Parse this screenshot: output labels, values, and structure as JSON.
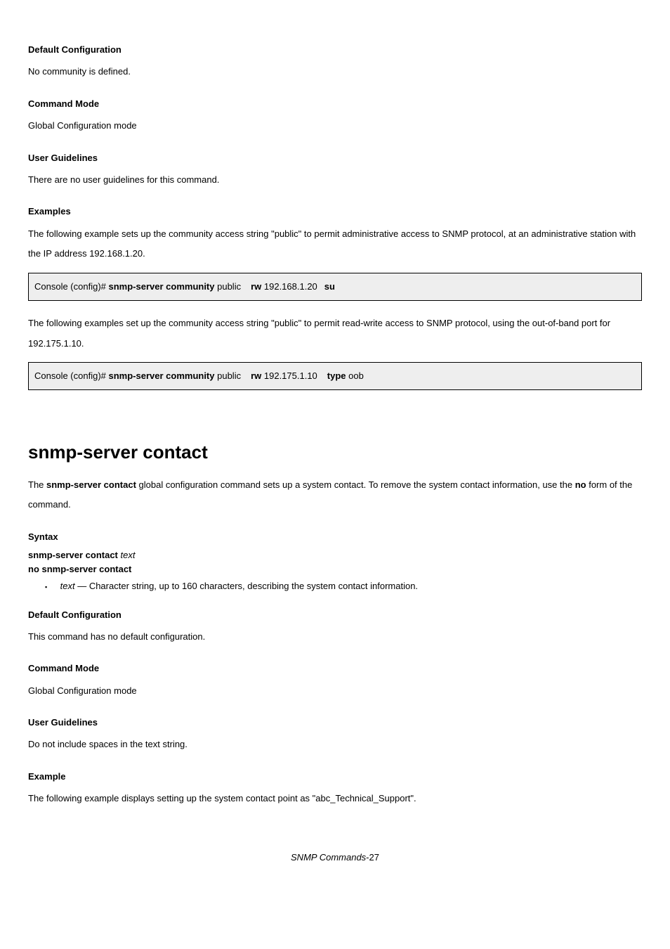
{
  "default_cfg": {
    "title": "Default Configuration",
    "text": "No community is defined."
  },
  "cmd_mode1": {
    "title": "Command Mode",
    "text": "Global Configuration mode"
  },
  "ug1": {
    "title": "User Guidelines",
    "text": "There are no user guidelines for this command."
  },
  "examples": {
    "title": "Examples",
    "para1": "The following example sets up the community access string \"public\" to permit administrative access to SNMP protocol, at an administrative station with the IP address 192.168.1.20.",
    "code1_prompt": "Console (config)# ",
    "code1_cmd": "snmp-server community ",
    "code1_arg1": "public",
    "code1_arg2": "192.168.1.20",
    "code1_su": "rw ",
    "code1_tail": "su",
    "para2": "The following examples set up the community access string \"public\" to permit read-write access to SNMP protocol, using the out-of-band port for 192.175.1.10.",
    "code2_prompt": "Console (config)# ",
    "code2_cmd": "snmp-server community ",
    "code2_arg1": "public",
    "code2_arg2": "192.175.1.10",
    "code2_rw": "rw ",
    "code2_arg3": "oob",
    "code2_type": "type "
  },
  "contact": {
    "heading": "snmp-server contact",
    "intro_pre": "The ",
    "intro_cmd": "snmp-server contact",
    "intro_post": " global configuration command sets up a system contact. To remove the system contact information, use the ",
    "intro_no": "no",
    "intro_tail": " form of the command."
  },
  "syntax": {
    "title": "Syntax",
    "line1_a": "snmp-server contact ",
    "line1_b": "text",
    "line2": "no snmp-server contact"
  },
  "param": {
    "name": "text",
    "desc": " — Character string, up to 160 characters, describing the system contact information."
  },
  "default2": {
    "title": "Default Configuration",
    "text": "This command has no default configuration."
  },
  "cmd_mode2": {
    "title": "Command Mode",
    "text": "Global Configuration mode"
  },
  "ug2": {
    "title": "User Guidelines",
    "text": "Do not include spaces in the text string."
  },
  "example2": {
    "title": "Example",
    "text": "The following example displays setting up the system contact point as \"abc_Technical_Support\"."
  },
  "page": {
    "prefix": "SNMP Commands",
    "num": "-27"
  }
}
